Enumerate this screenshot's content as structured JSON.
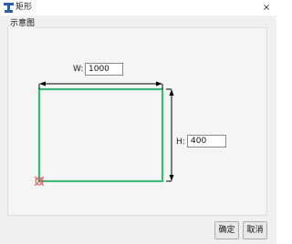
{
  "window": {
    "title": "矩形",
    "close_glyph": "×"
  },
  "group": {
    "label": "示意图"
  },
  "width_field": {
    "label": "W:",
    "value": "1000"
  },
  "height_field": {
    "label": "H:",
    "value": "400"
  },
  "buttons": {
    "ok": "确定",
    "cancel": "取消"
  },
  "colors": {
    "rect_stroke": "#3cb878",
    "origin_marker": "#e05050",
    "dimension_line": "#000000"
  }
}
